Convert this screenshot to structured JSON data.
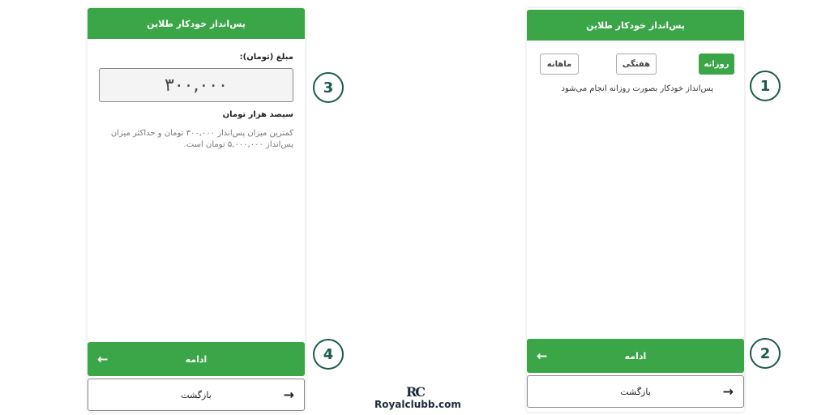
{
  "left_screen": {
    "header_title": "پس‌انداز خودکار طلاین",
    "amount_label": "مبلغ (تومان):",
    "amount_value": "۳۰۰,۰۰۰",
    "amount_words": "سیصد هزار تومان",
    "hint_text": "کمترین میزان پس‌انداز ۳۰۰,۰۰۰ تومان و حداکثر میزان پس‌انداز ۵,۰۰۰,۰۰۰ تومان است.",
    "continue_label": "ادامه",
    "back_label": "بازگشت"
  },
  "right_screen": {
    "header_title": "پس‌انداز خودکار طلاین",
    "frequency_options": {
      "daily": "روزانه",
      "weekly": "هفتگی",
      "monthly": "ماهانه",
      "selected": "روزانه"
    },
    "frequency_description": "پس‌انداز خودکار بصورت روزانه انجام می‌شود",
    "continue_label": "ادامه",
    "back_label": "بازگشت"
  },
  "steps": [
    "3",
    "4",
    "1",
    "2"
  ],
  "logo": {
    "mark": "RC",
    "text": "Royalclubb.com"
  },
  "colors": {
    "accent": "#3aa648",
    "step_ring": "#1c5a4e"
  },
  "icons": {
    "continue": "arrow-left-icon",
    "back": "arrow-right-icon"
  }
}
